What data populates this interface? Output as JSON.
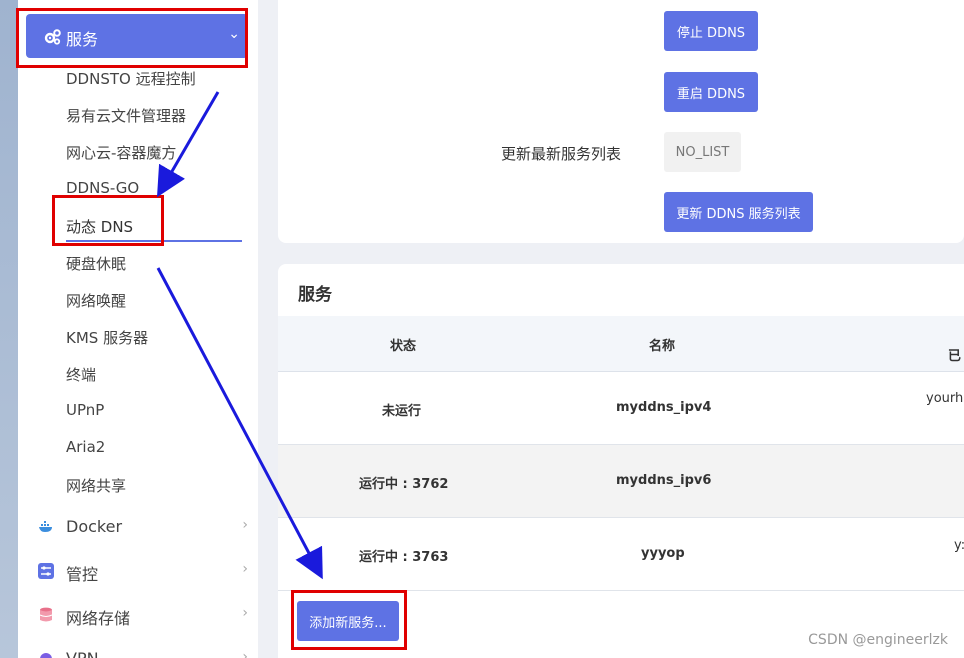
{
  "sidebar": {
    "active_menu": {
      "label": "服务",
      "icon": "gears-icon"
    },
    "sub_items": [
      {
        "label": "DDNSTO 远程控制"
      },
      {
        "label": "易有云文件管理器"
      },
      {
        "label": "网心云-容器魔方"
      },
      {
        "label": "DDNS-GO"
      },
      {
        "label": "动态 DNS"
      },
      {
        "label": "硬盘休眠"
      },
      {
        "label": "网络唤醒"
      },
      {
        "label": "KMS 服务器"
      },
      {
        "label": "终端"
      },
      {
        "label": "UPnP"
      },
      {
        "label": "Aria2"
      },
      {
        "label": "网络共享"
      }
    ],
    "main_items": [
      {
        "label": "Docker",
        "icon": "docker-icon"
      },
      {
        "label": "管控",
        "icon": "sliders-icon"
      },
      {
        "label": "网络存储",
        "icon": "database-icon"
      },
      {
        "label": "VPN",
        "icon": "vpn-icon"
      }
    ]
  },
  "ddns_panel": {
    "stop_button": "停止 DDNS",
    "restart_button": "重启 DDNS",
    "update_list_label": "更新最新服务列表",
    "no_list_button": "NO_LIST",
    "update_list_button": "更新 DDNS 服务列表"
  },
  "services": {
    "title": "服务",
    "columns": [
      "状态",
      "名称",
      "已"
    ],
    "rows": [
      {
        "status": "未运行",
        "name": "myddns_ipv4",
        "extra": "yourh"
      },
      {
        "status": "运行中 : 3762",
        "name": "myddns_ipv6",
        "extra": ""
      },
      {
        "status": "运行中 : 3763",
        "name": "yyyop",
        "extra": "y:"
      }
    ],
    "add_button": "添加新服务..."
  },
  "watermark": "CSDN @engineerlzk",
  "colors": {
    "accent": "#5e72e4",
    "annotation_red": "#e00000",
    "annotation_arrow": "#1a1adc"
  }
}
